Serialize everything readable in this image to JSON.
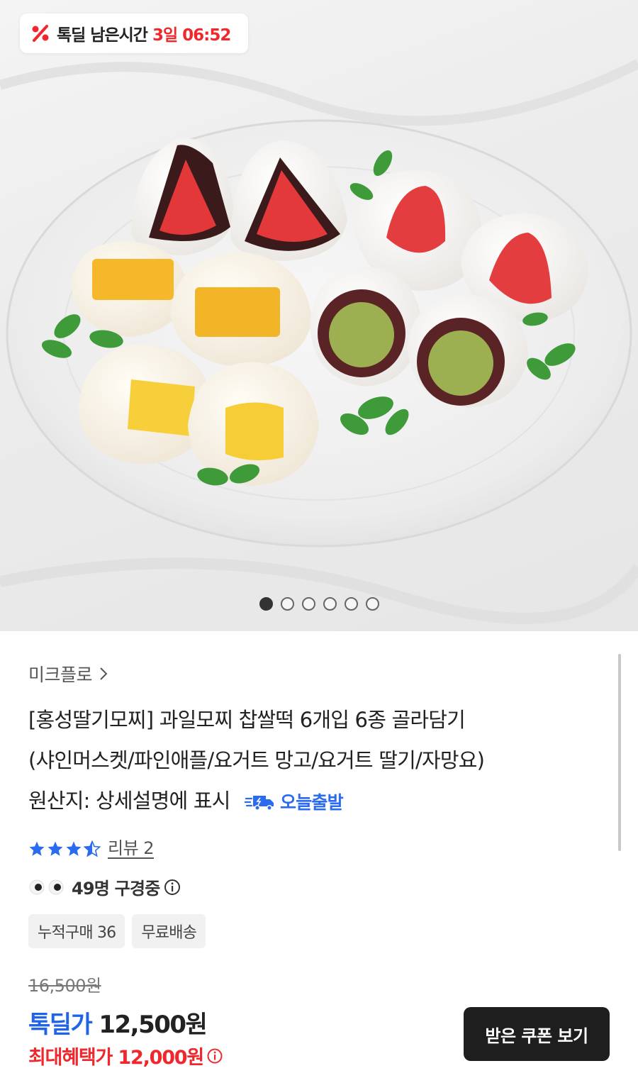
{
  "deal_timer": {
    "icon": "percent-icon",
    "label": "톡딜 남은시간",
    "remaining": "3일 06:52"
  },
  "gallery": {
    "image": "fruit-mochi-plate-photo",
    "page_count": 6,
    "current_page": 1
  },
  "product": {
    "brand": "미크플로",
    "title_line1": "[홍성딸기모찌] 과일모찌 찹쌀떡 6개입 6종 골라담기",
    "title_line2": "(샤인머스켓/파인애플/요거트 망고/요거트 딸기/자망요)",
    "title_line3": "원산지: 상세설명에 표시",
    "shipping_badge": "오늘출발",
    "rating": 3.5,
    "review_label": "리뷰 2",
    "viewers": "49명 구경중",
    "chips": [
      "누적구매 36",
      "무료배송"
    ]
  },
  "price": {
    "original": "16,500원",
    "deal_label": "톡딜가",
    "deal_value": "12,500원",
    "max_benefit": "최대혜택가 12,000원"
  },
  "coupon_button": "받은 쿠폰 보기",
  "colors": {
    "accent_red": "#f0282d",
    "accent_blue": "#1f63e8",
    "star": "#2a6bf0",
    "button_bg": "#1e1e1e"
  }
}
